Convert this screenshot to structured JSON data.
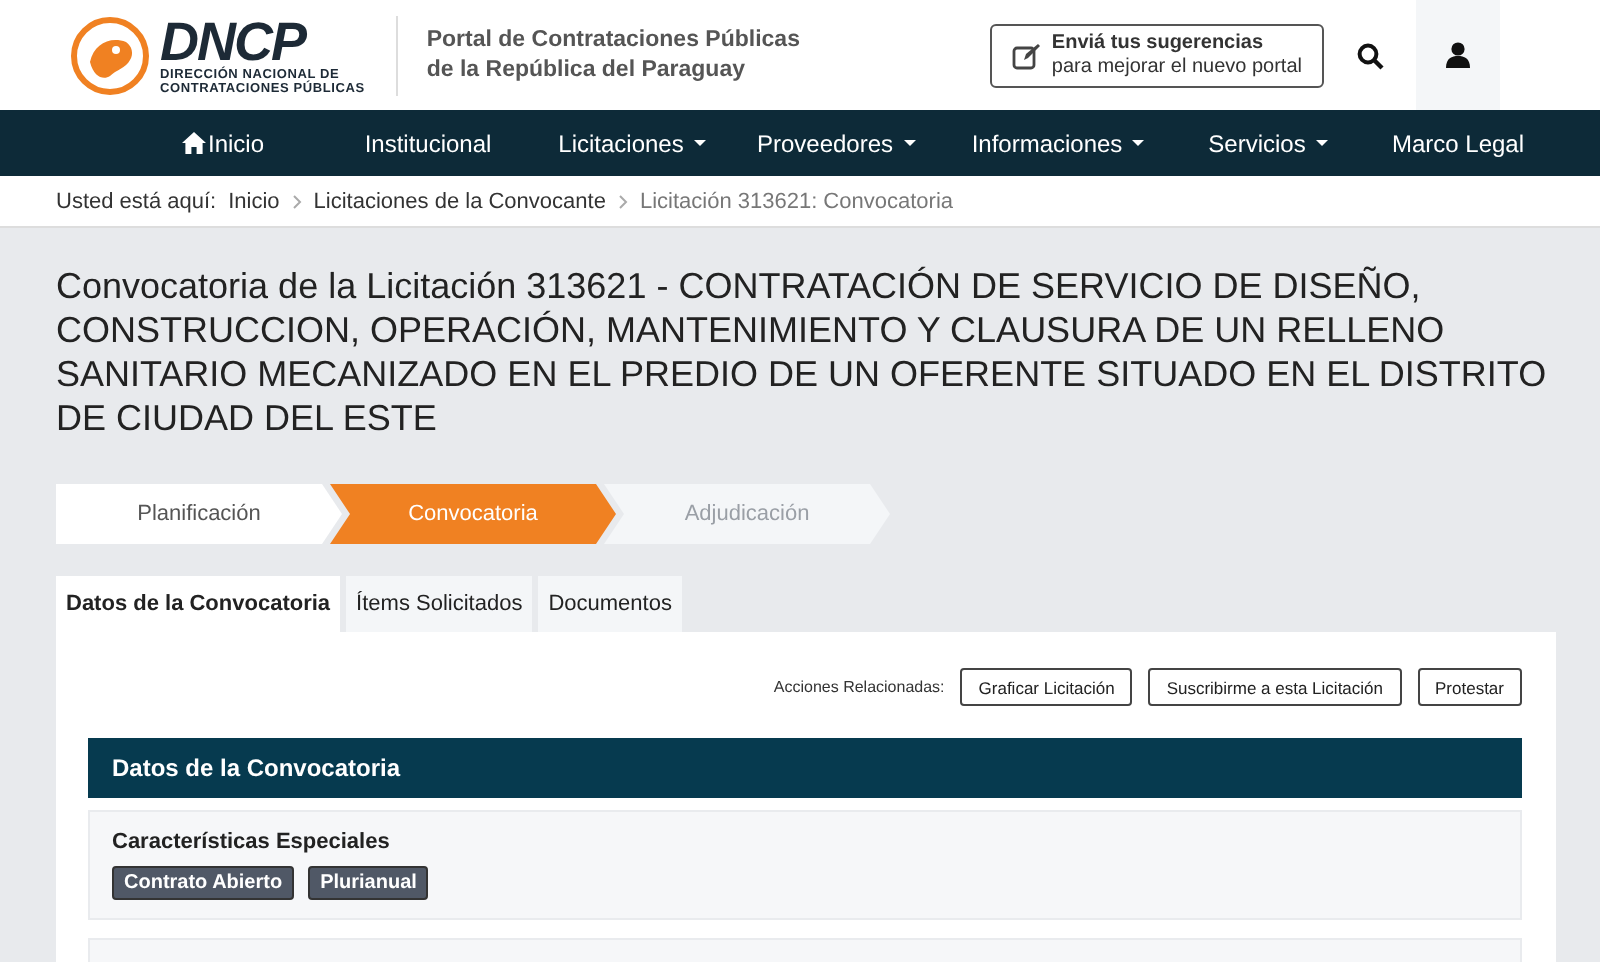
{
  "header": {
    "logo": {
      "name": "DNCP",
      "subtitle_1": "DIRECCIÓN NACIONAL DE",
      "subtitle_2": "CONTRATACIONES PÚBLICAS"
    },
    "portal_title_1": "Portal de Contrataciones Públicas",
    "portal_title_2": "de la República del Paraguay",
    "feedback_button": {
      "line_1": "Enviá tus sugerencias",
      "line_2": "para mejorar el nuevo portal"
    }
  },
  "nav": [
    {
      "label": "Inicio",
      "kind": "home",
      "dropdown": false
    },
    {
      "label": "Institucional",
      "kind": "text",
      "dropdown": false
    },
    {
      "label": "Licitaciones",
      "kind": "text",
      "dropdown": true
    },
    {
      "label": "Proveedores",
      "kind": "text",
      "dropdown": true
    },
    {
      "label": "Informaciones",
      "kind": "text",
      "dropdown": true
    },
    {
      "label": "Servicios",
      "kind": "text",
      "dropdown": true
    },
    {
      "label": "Marco Legal",
      "kind": "text",
      "dropdown": false
    }
  ],
  "breadcrumb": {
    "prefix": "Usted está aquí:",
    "items": [
      {
        "label": "Inicio",
        "current": false
      },
      {
        "label": "Licitaciones de la Convocante",
        "current": false
      },
      {
        "label": "Licitación 313621: Convocatoria",
        "current": true
      }
    ]
  },
  "title": "Convocatoria de la Licitación 313621 - CONTRATACIÓN DE SERVICIO DE DISEÑO, CONSTRUCCION, OPERACIÓN, MANTENIMIENTO Y CLAUSURA DE UN RELLENO SANITARIO MECANIZADO EN EL PREDIO DE UN OFERENTE SITUADO EN EL DISTRITO DE CIUDAD DEL ESTE",
  "steps": [
    {
      "label": "Planificación",
      "selected": false,
      "disabled": false
    },
    {
      "label": "Convocatoria",
      "selected": true,
      "disabled": false
    },
    {
      "label": "Adjudicación",
      "selected": false,
      "disabled": true
    }
  ],
  "tabs": [
    {
      "label": "Datos de la Convocatoria",
      "selected": true
    },
    {
      "label": "Ítems Solicitados",
      "selected": false
    },
    {
      "label": "Documentos",
      "selected": false
    }
  ],
  "actions": {
    "label": "Acciones Relacionadas:",
    "buttons": [
      "Graficar Licitación",
      "Suscribirme a esta Licitación",
      "Protestar"
    ]
  },
  "section_title": "Datos de la Convocatoria",
  "special": {
    "heading": "Características Especiales",
    "tags": [
      "Contrato Abierto",
      "Plurianual"
    ]
  }
}
